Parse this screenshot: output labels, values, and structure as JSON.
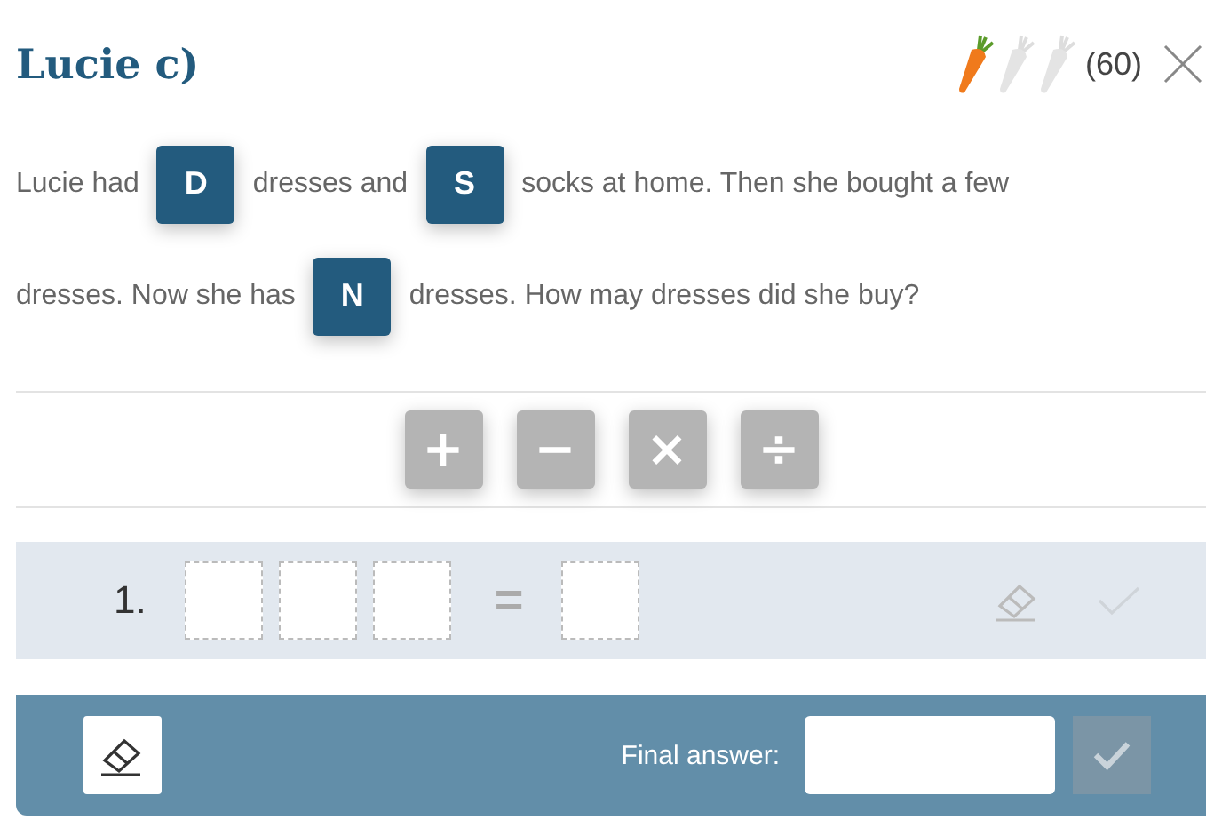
{
  "title": "Lucie c)",
  "rating": {
    "stars": 1,
    "points": "(60)"
  },
  "problem_lines": [
    [
      {
        "kind": "text",
        "text": "Lucie had"
      },
      {
        "kind": "token",
        "text": "D"
      },
      {
        "kind": "text",
        "text": "dresses and"
      },
      {
        "kind": "token",
        "text": "S"
      },
      {
        "kind": "text",
        "text": "socks at home. Then she bought a few"
      }
    ],
    [
      {
        "kind": "text",
        "text": "dresses. Now she has"
      },
      {
        "kind": "token",
        "text": "N"
      },
      {
        "kind": "text",
        "text": "dresses. How may dresses did she buy?"
      }
    ]
  ],
  "operators": [
    "+",
    "−",
    "×",
    "÷"
  ],
  "equation": {
    "number": "1.",
    "equals": "="
  },
  "footer": {
    "final_answer_label": "Final answer:"
  }
}
